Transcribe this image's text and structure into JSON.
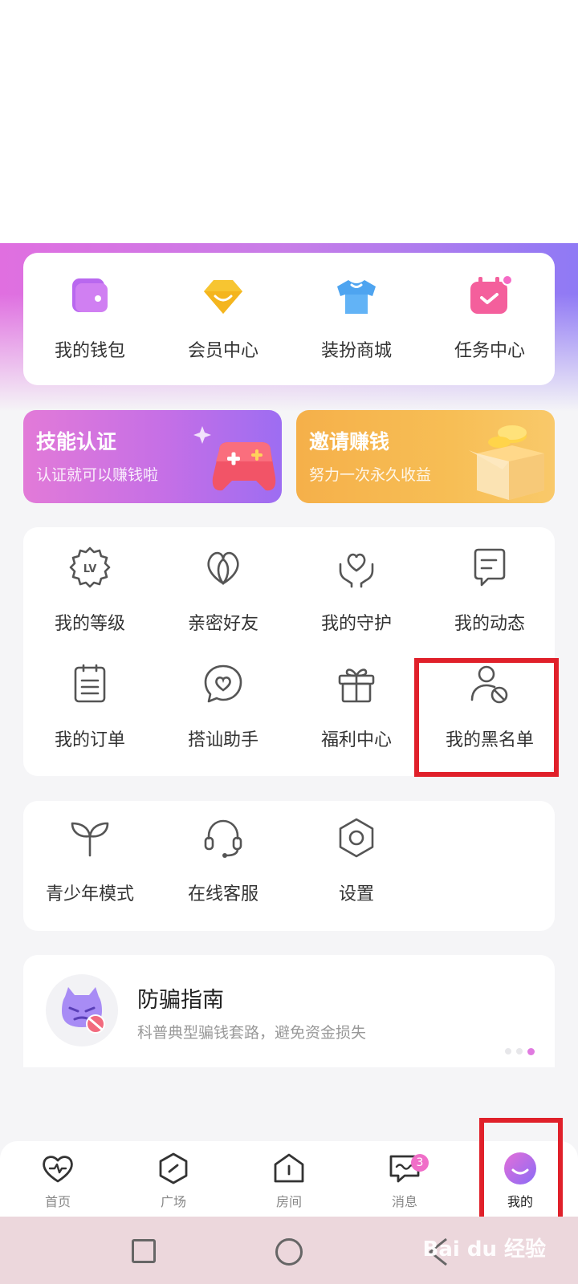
{
  "quick": [
    {
      "label": "我的钱包",
      "icon": "wallet-icon"
    },
    {
      "label": "会员中心",
      "icon": "diamond-icon"
    },
    {
      "label": "装扮商城",
      "icon": "tshirt-icon"
    },
    {
      "label": "任务中心",
      "icon": "calendar-check-icon"
    }
  ],
  "banners": {
    "skill": {
      "title": "技能认证",
      "subtitle": "认证就可以赚钱啦",
      "icon": "gamepad-icon"
    },
    "invite": {
      "title": "邀请赚钱",
      "subtitle": "努力一次永久收益",
      "icon": "treasure-box-icon"
    }
  },
  "functions": [
    {
      "label": "我的等级",
      "icon": "level-badge-icon"
    },
    {
      "label": "亲密好友",
      "icon": "intimate-heart-icon"
    },
    {
      "label": "我的守护",
      "icon": "guard-heart-icon"
    },
    {
      "label": "我的动态",
      "icon": "post-icon"
    },
    {
      "label": "我的订单",
      "icon": "order-list-icon"
    },
    {
      "label": "搭讪助手",
      "icon": "chat-heart-icon"
    },
    {
      "label": "福利中心",
      "icon": "gift-icon"
    },
    {
      "label": "我的黑名单",
      "icon": "blacklist-user-icon"
    }
  ],
  "misc": [
    {
      "label": "青少年模式",
      "icon": "sprout-icon"
    },
    {
      "label": "在线客服",
      "icon": "headset-icon"
    },
    {
      "label": "设置",
      "icon": "settings-hex-icon"
    }
  ],
  "guide": {
    "title": "防骗指南",
    "subtitle": "科普典型骗钱套路，避免资金损失",
    "icon": "anti-fraud-devil-icon"
  },
  "tabs": [
    {
      "label": "首页",
      "icon": "heartbeat-icon"
    },
    {
      "label": "广场",
      "icon": "square-compass-icon"
    },
    {
      "label": "房间",
      "icon": "room-house-icon"
    },
    {
      "label": "消息",
      "icon": "message-icon",
      "badge": "3"
    },
    {
      "label": "我的",
      "icon": "profile-smile-icon",
      "active": true
    }
  ],
  "watermark": "Bai du 经验",
  "colors": {
    "accent": "#c77de8",
    "highlight": "#e0202a",
    "badge": "#f06ec8"
  }
}
